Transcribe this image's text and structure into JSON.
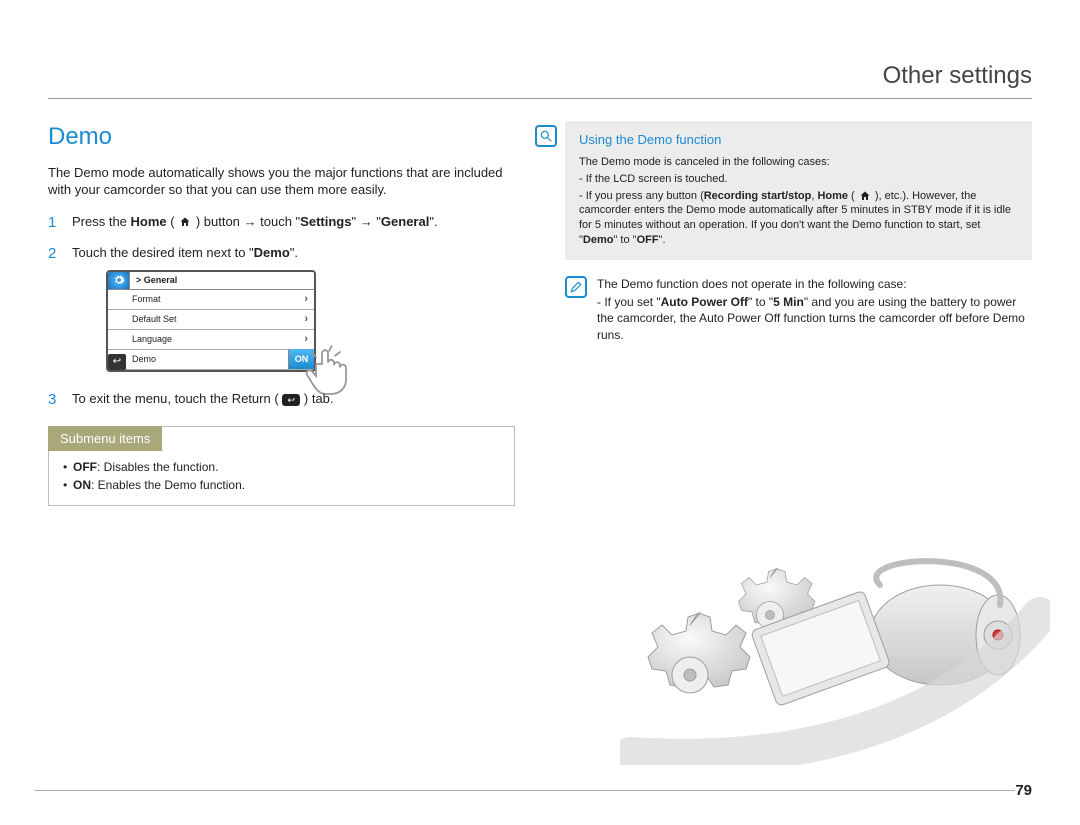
{
  "header": {
    "title": "Other settings"
  },
  "section": {
    "title": "Demo",
    "intro": "The Demo mode automatically shows you the major functions that are included with your camcorder so that you can use them more easily."
  },
  "steps": {
    "s1_a": "Press the ",
    "s1_home": "Home",
    "s1_b": " ( ",
    "s1_c": " ) button → touch \"",
    "s1_settings": "Settings",
    "s1_d": "\" → \"",
    "s1_general": "General",
    "s1_e": "\".",
    "s2_a": "Touch the desired item next to \"",
    "s2_demo": "Demo",
    "s2_b": "\".",
    "s3_a": "To exit the menu, touch the Return ( ",
    "s3_b": " ) tab."
  },
  "lcd": {
    "breadcrumb": "> General",
    "rows": [
      "Format",
      "Default Set",
      "Language",
      "Demo"
    ],
    "on_label": "ON"
  },
  "submenu": {
    "heading": "Submenu items",
    "off_label": "OFF",
    "off_desc": ": Disables the function.",
    "on_label": "ON",
    "on_desc": ": Enables the Demo function."
  },
  "tip": {
    "title": "Using the Demo function",
    "line1": "The Demo mode is canceled in the following cases:",
    "line2": "- If the LCD screen is touched.",
    "line3a": "- If you press any button (",
    "line3_rec": "Recording start/stop",
    "line3b": ", ",
    "line3_home": "Home",
    "line3c": " ( ",
    "line3d": " ), etc.). However, the camcorder enters the Demo mode automatically after 5 minutes in STBY mode if it is idle for 5 minutes without an operation. If you don't want the Demo function to start, set \"",
    "line3_demo": "Demo",
    "line3e": "\" to \"",
    "line3_off": "OFF",
    "line3f": "\"."
  },
  "note": {
    "line1": "The Demo function does not operate in the following case:",
    "line2a": "- If you set \"",
    "line2_apo": "Auto Power Off",
    "line2b": "\" to \"",
    "line2_5min": "5 Min",
    "line2c": "\" and you are using the battery to power the camcorder, the Auto Power Off function turns the camcorder off before Demo runs."
  },
  "page_number": "79"
}
